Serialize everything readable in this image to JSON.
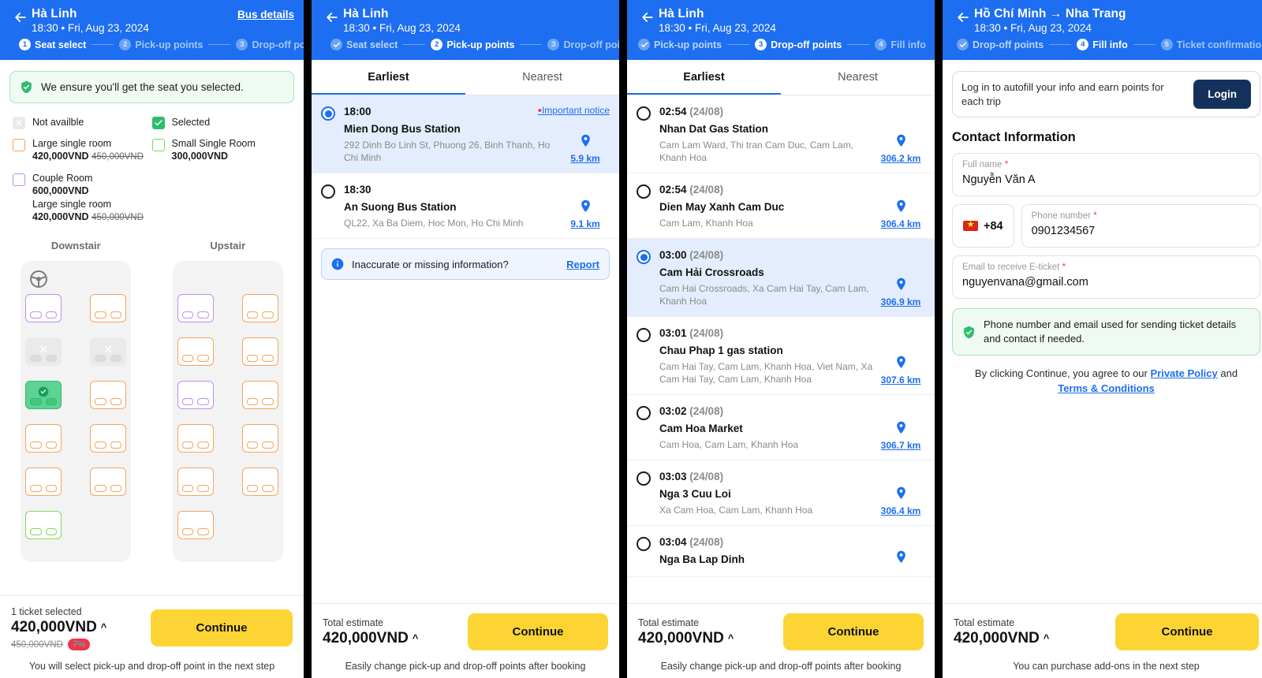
{
  "colors": {
    "brand_blue": "#1d6ef0",
    "cta_yellow": "#fcd535",
    "success_green": "#2dbd6e",
    "discount_red": "#f0334a",
    "login_navy": "#13315c",
    "seat_orange": "#f5a55c",
    "seat_purple": "#c08ef0",
    "seat_green": "#7ed957"
  },
  "panel1": {
    "header": {
      "back_icon": "arrow-left-icon",
      "title": "Hà Linh",
      "subtitle": "18:30 • Fri, Aug 23, 2024",
      "action_link": "Bus details",
      "steps": [
        {
          "num": "1",
          "label": "Seat select",
          "state": "active"
        },
        {
          "num": "2",
          "label": "Pick-up points",
          "state": "todo"
        },
        {
          "num": "3",
          "label": "Drop-off points",
          "state": "todo"
        }
      ]
    },
    "guarantee": {
      "icon": "shield-check-icon",
      "text": "We ensure you'll get the seat you selected."
    },
    "legend": [
      {
        "key": "not_available",
        "label": "Not availble",
        "price": "",
        "old_price": "",
        "swatch": "not-available"
      },
      {
        "key": "selected",
        "label": "Selected",
        "price": "",
        "old_price": "",
        "swatch": "selected"
      },
      {
        "key": "large_single",
        "label": "Large single room",
        "price": "420,000VND",
        "old_price": "450,000VND",
        "swatch": "large-single"
      },
      {
        "key": "small_single",
        "label": "Small Single Room",
        "price": "300,000VND",
        "old_price": "",
        "swatch": "small-single"
      },
      {
        "key": "couple",
        "label": "Couple Room",
        "price": "600,000VND",
        "old_price": "",
        "swatch": "couple"
      },
      {
        "key": "couple_sub",
        "label": "Large single room",
        "price": "420,000VND",
        "old_price": "450,000VND",
        "swatch": "none"
      }
    ],
    "decks": [
      {
        "title": "Downstair",
        "has_wheel": true,
        "wheel_icon": "steering-wheel-icon",
        "rows": [
          [
            "purple",
            "orange"
          ],
          [
            "na",
            "na"
          ],
          [
            "selected",
            "orange"
          ],
          [
            "orange",
            "orange"
          ],
          [
            "orange",
            "orange"
          ],
          [
            "green",
            "empty"
          ]
        ]
      },
      {
        "title": "Upstair",
        "has_wheel": false,
        "wheel_icon": "",
        "rows": [
          [
            "purple",
            "orange"
          ],
          [
            "orange",
            "orange"
          ],
          [
            "purple",
            "orange"
          ],
          [
            "orange",
            "orange"
          ],
          [
            "orange",
            "orange"
          ],
          [
            "orange",
            "empty"
          ]
        ]
      }
    ],
    "bottom": {
      "label": "1 ticket selected",
      "price": "420,000VND",
      "caret": "^",
      "old_price": "450,000VND",
      "discount": "7%",
      "button": "Continue",
      "note": "You will select pick-up and drop-off point in the next step"
    }
  },
  "panel2": {
    "header": {
      "back_icon": "arrow-left-icon",
      "title": "Hà Linh",
      "subtitle": "18:30 • Fri, Aug 23, 2024",
      "steps": [
        {
          "num": "✓",
          "label": "Seat select",
          "state": "done"
        },
        {
          "num": "2",
          "label": "Pick-up points",
          "state": "active"
        },
        {
          "num": "3",
          "label": "Drop-off points",
          "state": "todo"
        }
      ]
    },
    "tabs": [
      {
        "label": "Earliest",
        "active": true
      },
      {
        "label": "Nearest",
        "active": false
      }
    ],
    "points": [
      {
        "time": "18:00",
        "date": "",
        "name": "Mien Dong Bus Station",
        "address": "292 Dinh Bo Linh St, Phuong 26, Binh Thanh, Ho Chi Minh",
        "distance": "5.9 km",
        "selected": true,
        "notice": "Important notice"
      },
      {
        "time": "18:30",
        "date": "",
        "name": "An Suong Bus Station",
        "address": "QL22, Xa Ba Diem, Hoc Mon, Ho Chi Minh",
        "distance": "9.1 km",
        "selected": false,
        "notice": ""
      }
    ],
    "report": {
      "icon": "info-icon",
      "text": "Inaccurate or missing information?",
      "link": "Report"
    },
    "bottom": {
      "label": "Total estimate",
      "price": "420,000VND",
      "caret": "^",
      "button": "Continue",
      "note": "Easily change pick-up and drop-off points after booking"
    }
  },
  "panel3": {
    "header": {
      "back_icon": "arrow-left-icon",
      "title": "Hà Linh",
      "subtitle": "18:30 • Fri, Aug 23, 2024",
      "steps": [
        {
          "num": "✓",
          "label": "Pick-up points",
          "state": "done"
        },
        {
          "num": "3",
          "label": "Drop-off points",
          "state": "active"
        },
        {
          "num": "4",
          "label": "Fill info",
          "state": "todo"
        }
      ]
    },
    "tabs": [
      {
        "label": "Earliest",
        "active": true
      },
      {
        "label": "Nearest",
        "active": false
      }
    ],
    "points": [
      {
        "time": "02:54",
        "date": "(24/08)",
        "name": "Nhan Dat Gas Station",
        "address": "Cam Lam Ward, Thi tran Cam Duc, Cam Lam, Khanh Hoa",
        "distance": "306.2 km",
        "selected": false
      },
      {
        "time": "02:54",
        "date": "(24/08)",
        "name": "Dien May Xanh Cam Duc",
        "address": "Cam Lam, Khanh Hoa",
        "distance": "306.4 km",
        "selected": false
      },
      {
        "time": "03:00",
        "date": "(24/08)",
        "name": "Cam Hải Crossroads",
        "address": "Cam Hai Crossroads, Xa Cam Hai Tay, Cam Lam, Khanh Hoa",
        "distance": "306.9 km",
        "selected": true
      },
      {
        "time": "03:01",
        "date": "(24/08)",
        "name": "Chau Phap 1 gas station",
        "address": "Cam Hai Tay, Cam Lam, Khanh Hoa, Viet Nam, Xa Cam Hai Tay, Cam Lam, Khanh Hoa",
        "distance": "307.6 km",
        "selected": false
      },
      {
        "time": "03:02",
        "date": "(24/08)",
        "name": "Cam Hoa Market",
        "address": "Cam Hoa, Cam Lam, Khanh Hoa",
        "distance": "306.7 km",
        "selected": false
      },
      {
        "time": "03:03",
        "date": "(24/08)",
        "name": "Nga 3 Cuu Loi",
        "address": "Xa Cam Hoa, Cam Lam, Khanh Hoa",
        "distance": "306.4 km",
        "selected": false
      },
      {
        "time": "03:04",
        "date": "(24/08)",
        "name": "Nga Ba Lap Dinh",
        "address": "",
        "distance": "",
        "selected": false
      }
    ],
    "bottom": {
      "label": "Total estimate",
      "price": "420,000VND",
      "caret": "^",
      "button": "Continue",
      "note": "Easily change pick-up and drop-off points after booking"
    }
  },
  "panel4": {
    "header": {
      "back_icon": "arrow-left-icon",
      "title": "Hồ Chí Minh → Nha Trang",
      "subtitle": "18:30 • Fri, Aug 23, 2024",
      "steps": [
        {
          "num": "✓",
          "label": "Drop-off points",
          "state": "done"
        },
        {
          "num": "4",
          "label": "Fill info",
          "state": "active"
        },
        {
          "num": "5",
          "label": "Ticket confirmation",
          "state": "todo"
        }
      ]
    },
    "login_prompt": {
      "text": "Log in to autofill your info and earn points for each trip",
      "button": "Login"
    },
    "section_title": "Contact Information",
    "fields": [
      {
        "key": "full_name",
        "label": "Full name",
        "required": "*",
        "value": "Nguyễn Văn A"
      },
      {
        "key": "phone",
        "label": "Phone number",
        "required": "*",
        "value": "0901234567"
      },
      {
        "key": "email",
        "label": "Email to receive E-ticket",
        "required": "*",
        "value": "nguyenvana@gmail.com"
      }
    ],
    "country_code": "+84",
    "flag_icon": "vietnam-flag-icon",
    "assurance": {
      "icon": "shield-check-icon",
      "text": "Phone number and email used for sending ticket details and contact if needed."
    },
    "terms": {
      "prefix": "By clicking Continue, you agree to our ",
      "link1": "Private Policy",
      "middle": " and",
      "link2": "Terms & Conditions"
    },
    "bottom": {
      "label": "Total estimate",
      "price": "420,000VND",
      "caret": "^",
      "button": "Continue",
      "note": "You can purchase add-ons in the next step"
    }
  }
}
